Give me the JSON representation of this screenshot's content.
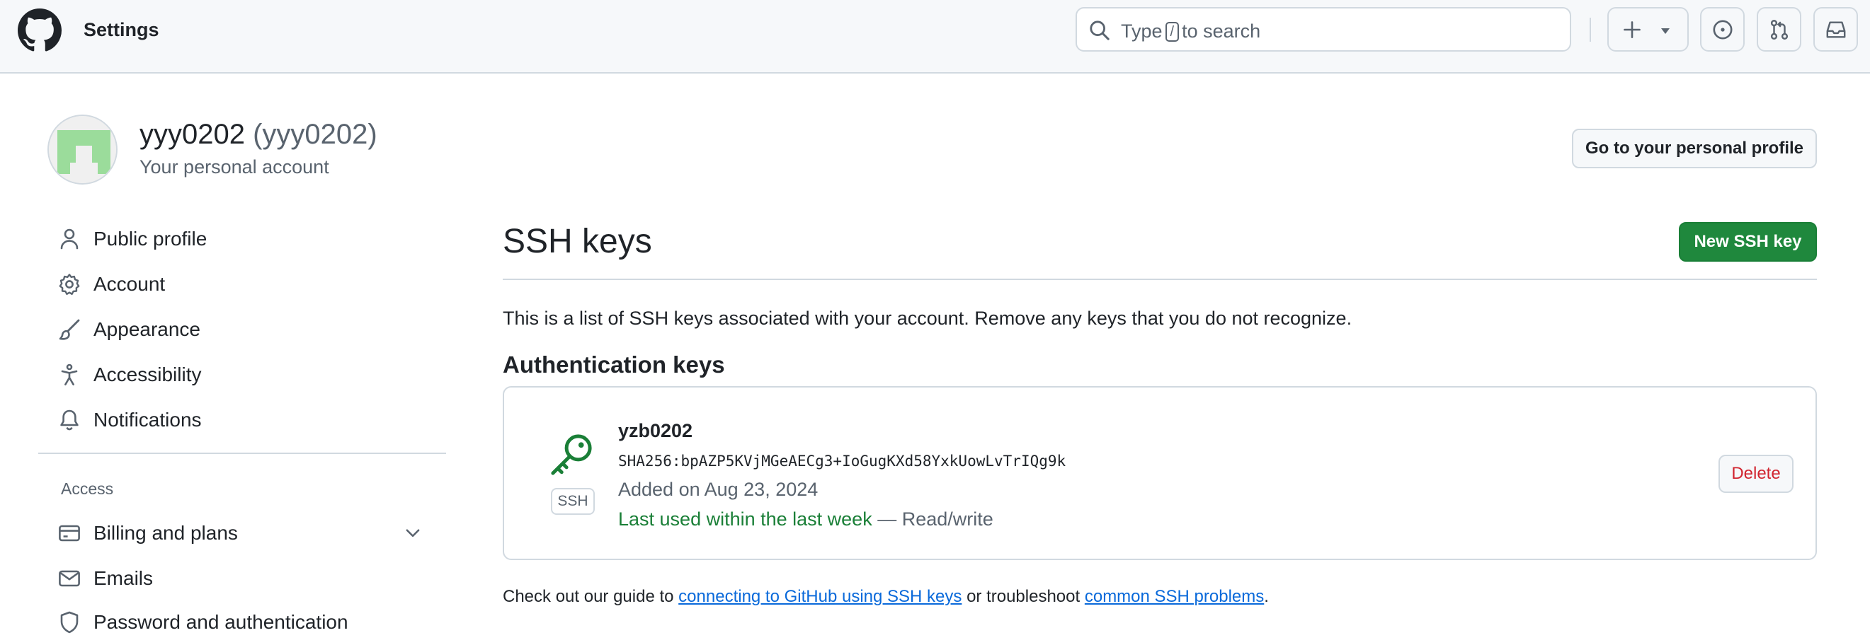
{
  "header": {
    "title": "Settings",
    "search_prefix": "Type",
    "search_key": "/",
    "search_suffix": "to search"
  },
  "user": {
    "display_name": "yyy0202",
    "handle": "(yyy0202)",
    "subtitle": "Your personal account",
    "profile_button": "Go to your personal profile"
  },
  "sidebar": {
    "items": [
      {
        "label": "Public profile",
        "icon": "person-icon"
      },
      {
        "label": "Account",
        "icon": "gear-icon"
      },
      {
        "label": "Appearance",
        "icon": "paintbrush-icon"
      },
      {
        "label": "Accessibility",
        "icon": "accessibility-icon"
      },
      {
        "label": "Notifications",
        "icon": "bell-icon"
      }
    ],
    "access_heading": "Access",
    "access_items": [
      {
        "label": "Billing and plans",
        "icon": "credit-card-icon"
      },
      {
        "label": "Emails",
        "icon": "mail-icon"
      },
      {
        "label": "Password and authentication",
        "icon": "shield-lock-icon"
      }
    ]
  },
  "main": {
    "title": "SSH keys",
    "new_button": "New SSH key",
    "intro": "This is a list of SSH keys associated with your account. Remove any keys that you do not recognize.",
    "auth_heading": "Authentication keys",
    "key": {
      "name": "yzb0202",
      "fingerprint": "SHA256:bpAZP5KVjMGeAECg3+IoGugKXd58YxkUowLvTrIQg9k",
      "added": "Added on Aug 23, 2024",
      "last_used": "Last used within the last week",
      "access": "— Read/write",
      "badge": "SSH",
      "delete_label": "Delete"
    },
    "footer": {
      "pre": "Check out our guide to",
      "link1": "connecting to GitHub using SSH keys",
      "mid": "or troubleshoot",
      "link2": "common SSH problems",
      "post": "."
    }
  },
  "colors": {
    "primary_button": "#1f883d",
    "link": "#0969da",
    "danger": "#d1242f",
    "success_text": "#1a7f37"
  }
}
